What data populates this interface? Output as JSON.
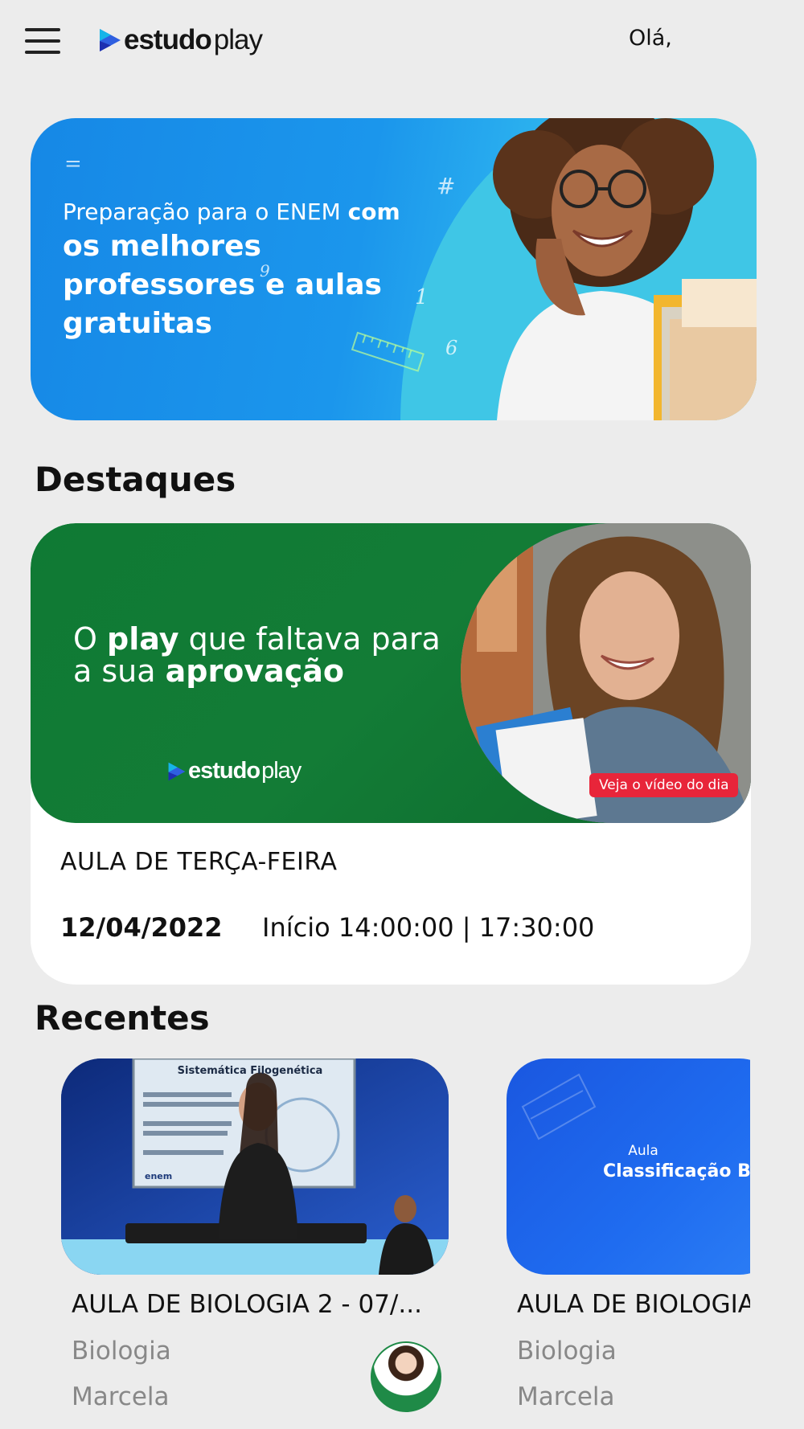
{
  "header": {
    "logo_bold": "estudo",
    "logo_light": "play",
    "greeting": "Olá,"
  },
  "hero": {
    "line1_regular": "Preparação para o ENEM ",
    "line1_bold": "com",
    "line2": "os melhores",
    "line3": "professores e aulas",
    "line4": "gratuitas"
  },
  "destaques": {
    "title": "Destaques",
    "banner": {
      "text_1": "O ",
      "text_2": "play",
      "text_3": " que faltava para",
      "text_4": "a sua ",
      "text_5": "aprovação",
      "logo_bold": "estudo",
      "logo_light": "play",
      "badge": "Veja o vídeo do dia"
    },
    "subtitle": "AULA DE TERÇA-FEIRA",
    "date": "12/04/2022",
    "time": "Início 14:00:00 |  17:30:00"
  },
  "recentes": {
    "title": "Recentes",
    "items": [
      {
        "slide_title": "Sistemática Filogenética",
        "logo": "enem",
        "title": "AULA DE BIOLOGIA 2 - 07/...",
        "subject": "Biologia",
        "teacher": "Marcela"
      },
      {
        "slide_small": "Aula",
        "slide_big": "Classificação Biol",
        "title": "AULA DE BIOLOGIA",
        "subject": "Biologia",
        "teacher": "Marcela"
      }
    ]
  },
  "colors": {
    "background": "#ececec",
    "hero_blue": "#1b96ec",
    "feature_green": "#137c36",
    "badge_red": "#e8253a",
    "muted_text": "#888888"
  }
}
